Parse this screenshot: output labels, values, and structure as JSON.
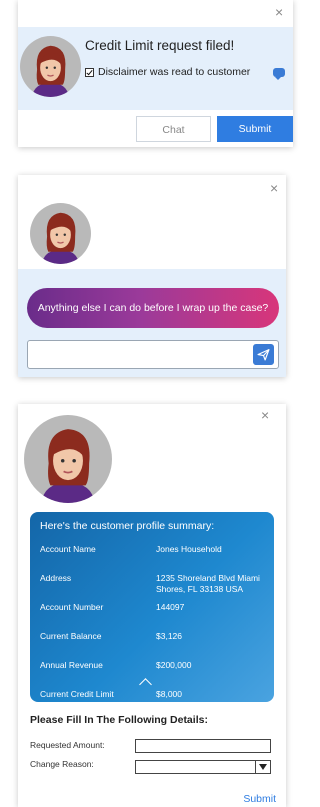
{
  "notification": {
    "close_icon": "×",
    "title": "Credit Limit request filed!",
    "disclaimer": "Disclaimer was read to customer",
    "chat_label": "Chat",
    "submit_label": "Submit",
    "accent": "#2f7de1"
  },
  "prompt": {
    "close_icon": "×",
    "message": "Anything else I can do before I wrap up the case?",
    "input_value": ""
  },
  "profile": {
    "close_icon": "×",
    "heading": "Here's the customer profile summary:",
    "rows": [
      {
        "label": "Account Name",
        "value": "Jones Household"
      },
      {
        "label": "Address",
        "value": "1235 Shoreland Blvd Miami Shores, FL 33138 USA"
      },
      {
        "label": "Account Number",
        "value": "144097"
      },
      {
        "label": "Current Balance",
        "value": "$3,126"
      },
      {
        "label": "Annual Revenue",
        "value": "$200,000"
      },
      {
        "label": "Current Credit Limit",
        "value": "$8,000"
      }
    ],
    "form_title": "Please Fill In The Following Details:",
    "requested_amount_label": "Requested Amount:",
    "change_reason_label": "Change Reason:",
    "requested_amount_value": "",
    "change_reason_value": "",
    "submit_label": "Submit"
  }
}
